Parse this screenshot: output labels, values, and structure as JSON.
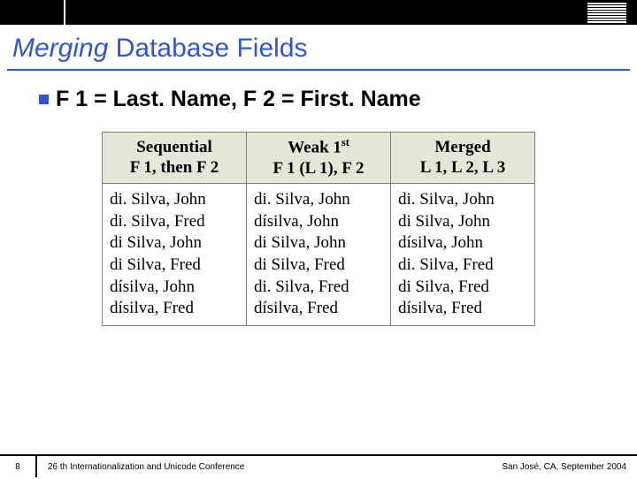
{
  "header": {
    "logo_name": "ibm-logo"
  },
  "title": {
    "emph": "Merging",
    "rest": " Database Fields"
  },
  "bullet": "F 1 = Last. Name, F 2 = First. Name",
  "table": {
    "headers": {
      "col1_line1": "Sequential",
      "col1_line2": "F 1, then F 2",
      "col2_line1_a": "Weak 1",
      "col2_line1_sup": "st",
      "col2_line2": "F 1 (L 1), F 2",
      "col3_line1": "Merged",
      "col3_line2": "L 1, L 2, L 3"
    },
    "rows": {
      "c1": [
        "di. Silva, John",
        "di. Silva, Fred",
        "di Silva, John",
        "di Silva, Fred",
        "dísilva, John",
        "dísilva, Fred"
      ],
      "c2": [
        "di. Silva, John",
        "dísilva, John",
        "di Silva, John",
        "di Silva, Fred",
        "di. Silva, Fred",
        "dísilva, Fred"
      ],
      "c3": [
        "di. Silva, John",
        "di Silva, John",
        "dísilva, John",
        "di. Silva, Fred",
        "di Silva, Fred",
        "dísilva, Fred"
      ]
    }
  },
  "footer": {
    "page": "8",
    "left": "26 th Internationalization and Unicode Conference",
    "right": "San José, CA, September 2004"
  }
}
